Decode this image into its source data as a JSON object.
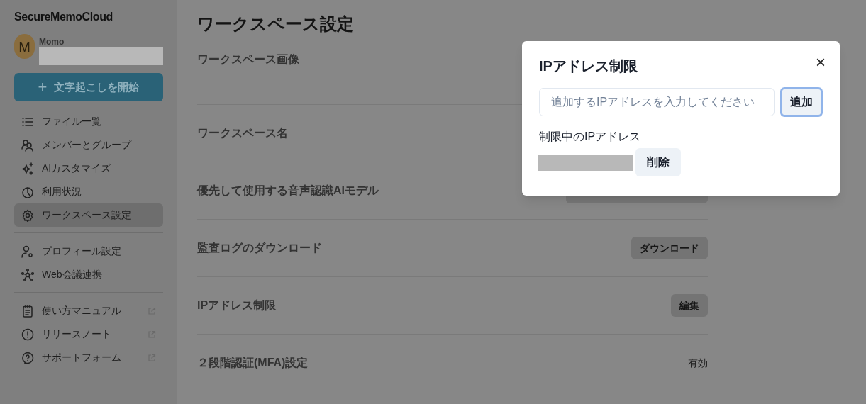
{
  "sidebar": {
    "logo": "SecureMemoCloud",
    "user": {
      "avatar_letter": "M",
      "name": "Momo"
    },
    "start_button": {
      "icon": "+",
      "label": "文字起こしを開始"
    },
    "groups": [
      {
        "items": [
          {
            "kind": "list",
            "label": "ファイル一覧",
            "selected": false,
            "external": false
          },
          {
            "kind": "members",
            "label": "メンバーとグループ",
            "selected": false,
            "external": false
          },
          {
            "kind": "sparkle",
            "label": "AIカスタマイズ",
            "selected": false,
            "external": false
          },
          {
            "kind": "usage",
            "label": "利用状況",
            "selected": false,
            "external": false
          },
          {
            "kind": "gear",
            "label": "ワークスペース設定",
            "selected": true,
            "external": false
          }
        ]
      },
      {
        "items": [
          {
            "kind": "profile",
            "label": "プロフィール設定",
            "selected": false,
            "external": false
          },
          {
            "kind": "network",
            "label": "Web会議連携",
            "selected": false,
            "external": false
          }
        ]
      },
      {
        "items": [
          {
            "kind": "notepad",
            "label": "使い方マニュアル",
            "selected": false,
            "external": true
          },
          {
            "kind": "alert",
            "label": "リリースノート",
            "selected": false,
            "external": true
          },
          {
            "kind": "help",
            "label": "サポートフォーム",
            "selected": false,
            "external": true
          }
        ]
      }
    ]
  },
  "main": {
    "title": "ワークスペース設定",
    "rows": [
      {
        "kind": "tall",
        "label": "ワークスペース画像"
      },
      {
        "kind": "plain",
        "label": "ワークスペース名"
      },
      {
        "kind": "select",
        "label": "優先して使用する音声認識AIモデル"
      },
      {
        "kind": "button",
        "label": "監査ログのダウンロード",
        "action": "ダウンロード"
      },
      {
        "kind": "button",
        "label": "IPアドレス制限",
        "action": "編集"
      },
      {
        "kind": "value",
        "label": "２段階認証(MFA)設定",
        "value": "有効"
      }
    ]
  },
  "dialog": {
    "title": "IPアドレス制限",
    "close": "×",
    "input": {
      "placeholder": "追加するIPアドレスを入力してください"
    },
    "add_button": "追加",
    "list_label": "制限中のIPアドレス",
    "entries": [
      {
        "delete_button": "削除"
      }
    ]
  }
}
